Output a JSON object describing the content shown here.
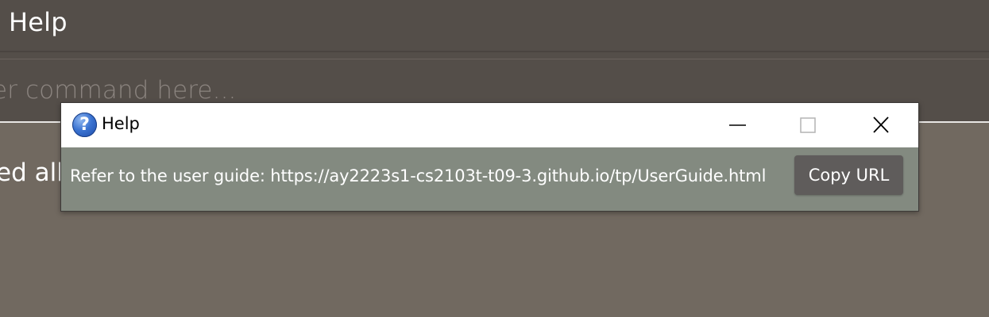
{
  "background": {
    "menu_help_label": "Help",
    "command_placeholder": "er command here...",
    "result_text": "ed all"
  },
  "dialog": {
    "title": "Help",
    "title_icon": "question-icon",
    "title_icon_glyph": "?",
    "guide_text": "Refer to the user guide: https://ay2223s1-cs2103t-t09-3.github.io/tp/UserGuide.html",
    "copy_button_label": "Copy URL"
  },
  "colors": {
    "dialog_body": "#838a80",
    "button": "#5f5c5b",
    "menubar": "#544e49",
    "result_area": "#716960"
  }
}
